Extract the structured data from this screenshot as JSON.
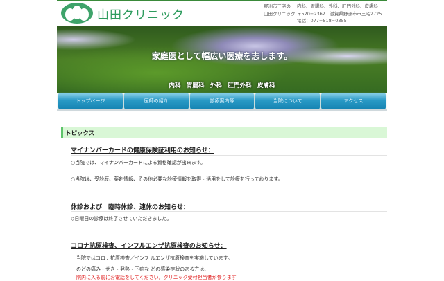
{
  "header": {
    "logo_text": "山田クリニック",
    "info": [
      {
        "label": "野洲市三宅の",
        "value": "内科、胃腸科、外科、肛門外科、皮膚科"
      },
      {
        "label": "山田クリニック",
        "value": "〒520−2362　滋賀県野洲市市三宅2725"
      },
      {
        "label": "",
        "value": "電話：077−518−0355"
      }
    ]
  },
  "banner": {
    "slogan": "家庭医として幅広い医療を志します。",
    "departments": "内科　胃腸科　外科　肛門外科　皮膚科"
  },
  "nav": [
    "トップページ",
    "医師の紹介",
    "診療案内等",
    "当院について",
    "アクセス"
  ],
  "topics": {
    "title": "トピックス",
    "sections": [
      {
        "heading": "マイナンバーカードの健康保険証利用のお知らせ：",
        "lines": [
          "○当院では、マイナンバーカードによる資格確認が出来ます。",
          "○当院は、受診歴、薬剤情報、その他必要な診療情報を取得・活用をして診療を行っております。"
        ]
      },
      {
        "heading": "休診および　臨時休診、連休のお知らせ：",
        "lines": [
          "◇日曜日の診療は終了させていただきました。"
        ]
      },
      {
        "heading": "コロナ抗原検査、インフルエンザ抗原検査のお知らせ：",
        "lines": [
          "当院ではコロナ抗原検査／インフ ルエンザ抗原検査を実施しています。",
          "のどの痛み・せき・発熱・下痢な どの感染症状のある方は、",
          "院内に入る前にお電話をしてください。クリニック受付担当者が参ります"
        ]
      }
    ]
  }
}
